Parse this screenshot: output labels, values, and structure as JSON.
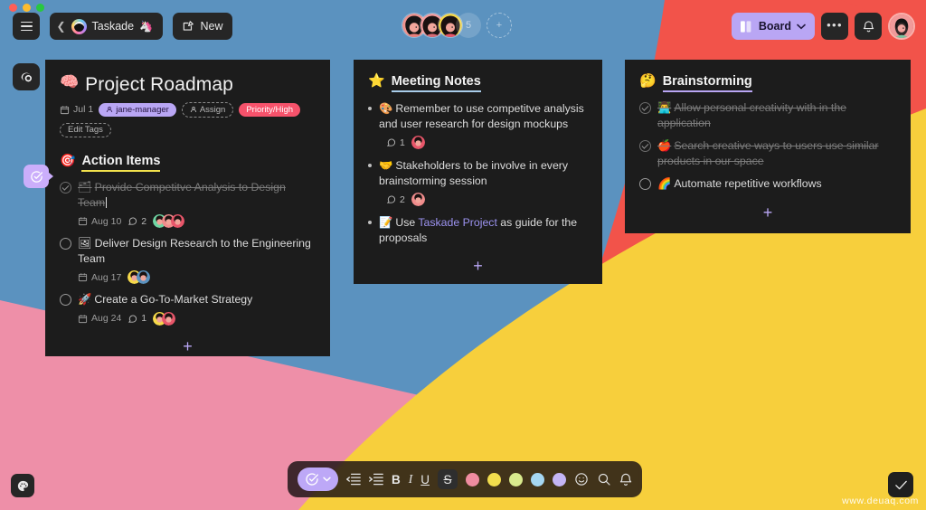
{
  "window": {
    "traffic_lights": [
      "close",
      "minimize",
      "maximize"
    ]
  },
  "topbar": {
    "menu_icon": "hamburger-icon",
    "back_chevron": "chevron-left-icon",
    "workspace_name": "Taskade",
    "workspace_emoji": "🦄",
    "new_label": "New",
    "new_icon": "compose-icon",
    "view_label": "Board",
    "view_icon": "board-columns-icon",
    "view_chevron": "chevron-down-icon",
    "more_icon": "ellipsis-icon",
    "bell_icon": "bell-icon",
    "me_avatar": "user-avatar"
  },
  "collaborators": {
    "avatars": [
      "collaborator-1",
      "collaborator-2",
      "collaborator-3"
    ],
    "overflow_count": "5",
    "add_label": "+"
  },
  "rail": {
    "logo_icon": "taskade-logo-icon",
    "active_tab_icon": "check-circle-icon",
    "palette_icon": "palette-icon",
    "confirm_icon": "check-icon"
  },
  "cards": [
    {
      "id": "project-roadmap",
      "emoji": "🧠",
      "title": "Project Roadmap",
      "date": "Jul 1",
      "tags": [
        {
          "label": "jane-manager",
          "style": "assigned"
        },
        {
          "label": "Assign",
          "style": "assign"
        },
        {
          "label": "Priority/High",
          "style": "priority"
        },
        {
          "label": "Edit Tags",
          "style": "edit"
        }
      ],
      "section": {
        "emoji": "🎯",
        "title": "Action Items",
        "underline": "#f2e14c"
      },
      "tasks": [
        {
          "checked": true,
          "strike": true,
          "emoji": "🗂",
          "text": "Provide Competitve Analysis to Design Team",
          "caret": true,
          "date": "Aug 10",
          "comments": "2",
          "avatars": 3
        },
        {
          "checked": false,
          "strike": false,
          "emoji": "🖼",
          "text": "Deliver Design Research to the Engineering Team",
          "caret": false,
          "date": "Aug 17",
          "comments": "",
          "avatars": 2
        },
        {
          "checked": false,
          "strike": false,
          "emoji": "🚀",
          "text": "Create a Go-To-Market Strategy",
          "caret": false,
          "date": "Aug 24",
          "comments": "1",
          "avatars": 2
        }
      ],
      "add_label": "+"
    },
    {
      "id": "meeting-notes",
      "emoji": "⭐",
      "title": "Meeting Notes",
      "underline": "#a9cdea",
      "bullets": [
        {
          "emoji": "🎨",
          "text": "Remember to use competitve analysis and user research for design mockups",
          "comments": "1",
          "avatars": 1
        },
        {
          "emoji": "🤝",
          "text": "Stakeholders to be involve in every brainstorming session",
          "comments": "2",
          "avatars": 1
        },
        {
          "emoji": "📝",
          "text_before": "Use ",
          "link": "Taskade Project",
          "text_after": " as guide for the proposals",
          "comments": "",
          "avatars": 0
        }
      ],
      "add_label": "+"
    },
    {
      "id": "brainstorming",
      "emoji": "🤔",
      "title": "Brainstorming",
      "underline": "#b9a6f4",
      "tasks": [
        {
          "checked": true,
          "strike": true,
          "emoji": "👨‍💻",
          "text": "Allow personal creativity with in the application"
        },
        {
          "checked": true,
          "strike": true,
          "emoji": "🍎",
          "text": "Search creative ways to users use similar products in our space"
        },
        {
          "checked": false,
          "strike": false,
          "emoji": "🌈",
          "text": "Automate repetitive workflows"
        }
      ],
      "add_label": "+"
    }
  ],
  "toolbar": {
    "mode_icon": "check-circle-icon",
    "mode_chevron": "chevron-down-icon",
    "outdent_icon": "outdent-icon",
    "indent_icon": "indent-icon",
    "bold_label": "B",
    "italic_label": "I",
    "underline_label": "U",
    "strike_label": "S",
    "swatches": [
      "#f08ca0",
      "#f2dd4d",
      "#d9ea8d",
      "#a5d7f2",
      "#c4b5f5"
    ],
    "emoji_icon": "smiley-icon",
    "search_icon": "search-icon",
    "bell_icon": "bell-icon"
  },
  "watermark": "www.deuaq.com",
  "theme": {
    "bg_blue": "#5b92bf",
    "bg_red": "#f2534a",
    "bg_pink": "#ee8fa8",
    "bg_yellow": "#f7cf3c",
    "card_bg": "#1c1c1c",
    "accent_purple": "#b9a6f4"
  }
}
